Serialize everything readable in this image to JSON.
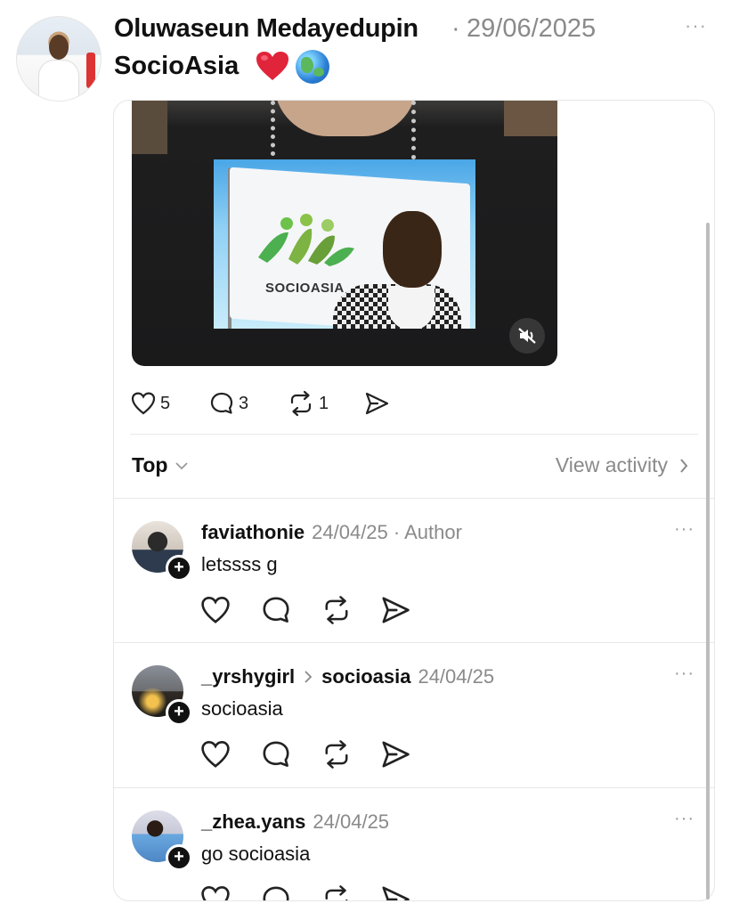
{
  "post": {
    "author": "Oluwaseun Medayedupin",
    "separator": "·",
    "date": "29/06/2025",
    "more": "···",
    "text": "SocioAsia",
    "emoji": [
      "red-heart",
      "globe-asia"
    ]
  },
  "media": {
    "logo_text": "SOCIOASIA",
    "muted": true
  },
  "stats": {
    "likes": "5",
    "comments": "3",
    "reposts": "1"
  },
  "filter": {
    "sort_label": "Top",
    "view_activity": "View activity"
  },
  "comments": [
    {
      "user": "faviathonie",
      "meta": "24/04/25 · Author",
      "text": "letssss g",
      "more": "···"
    },
    {
      "user": "_yrshygirl",
      "reply_to": "socioasia",
      "date": "24/04/25",
      "text": "socioasia",
      "more": "···"
    },
    {
      "user": "_zhea.yans",
      "date": "24/04/25",
      "text": "go socioasia",
      "more": "···"
    }
  ],
  "colors": {
    "muted_text": "#8a8a8a",
    "divider": "#e8e8e8",
    "heart": "#e0243a"
  }
}
